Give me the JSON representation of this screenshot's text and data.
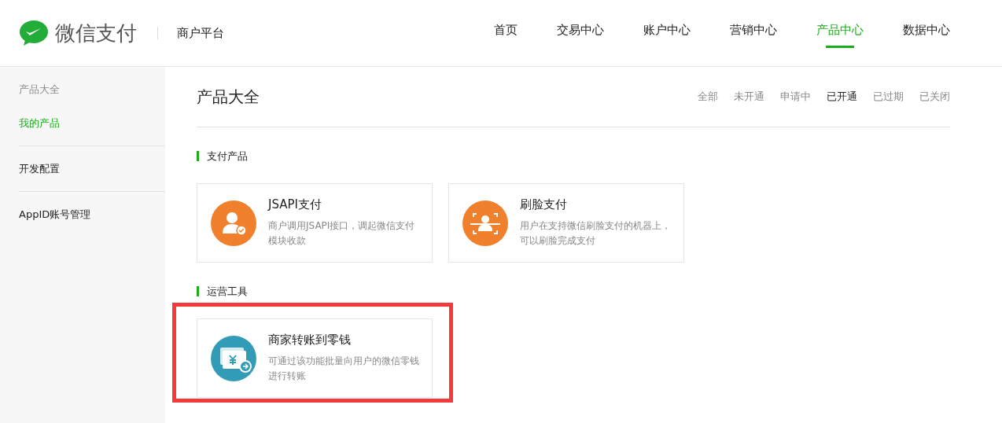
{
  "header": {
    "brand": "微信支付",
    "subtitle": "商户平台",
    "nav": [
      {
        "label": "首页",
        "selected": false
      },
      {
        "label": "交易中心",
        "selected": false
      },
      {
        "label": "账户中心",
        "selected": false
      },
      {
        "label": "营销中心",
        "selected": false
      },
      {
        "label": "产品中心",
        "selected": true
      },
      {
        "label": "数据中心",
        "selected": false
      }
    ]
  },
  "sidebar": {
    "groups": [
      {
        "heading": "产品大全",
        "items": [
          {
            "label": "我的产品",
            "selected": true
          }
        ]
      },
      {
        "items": [
          {
            "label": "开发配置",
            "selected": false
          }
        ]
      },
      {
        "items": [
          {
            "label": "AppID账号管理",
            "selected": false
          }
        ]
      }
    ]
  },
  "main": {
    "title": "产品大全",
    "filters": [
      {
        "label": "全部",
        "selected": false
      },
      {
        "label": "未开通",
        "selected": false
      },
      {
        "label": "申请中",
        "selected": false
      },
      {
        "label": "已开通",
        "selected": true
      },
      {
        "label": "已过期",
        "selected": false
      },
      {
        "label": "已关闭",
        "selected": false
      }
    ],
    "sections": [
      {
        "title": "支付产品",
        "cards": [
          {
            "kind": "person",
            "color": "#f0802b",
            "title": "JSAPI支付",
            "description": "商户调用JSAPI接口，调起微信支付模块收款",
            "highlighted": false
          },
          {
            "kind": "face",
            "color": "#f0802b",
            "title": "刷脸支付",
            "description": "用户在支持微信刷脸支付的机器上，可以刷脸完成支付",
            "highlighted": false
          }
        ]
      },
      {
        "title": "运营工具",
        "cards": [
          {
            "kind": "money",
            "color": "#329bb5",
            "title": "商家转账到零钱",
            "description": "可通过该功能批量向用户的微信零钱进行转账",
            "highlighted": true
          }
        ]
      }
    ]
  }
}
